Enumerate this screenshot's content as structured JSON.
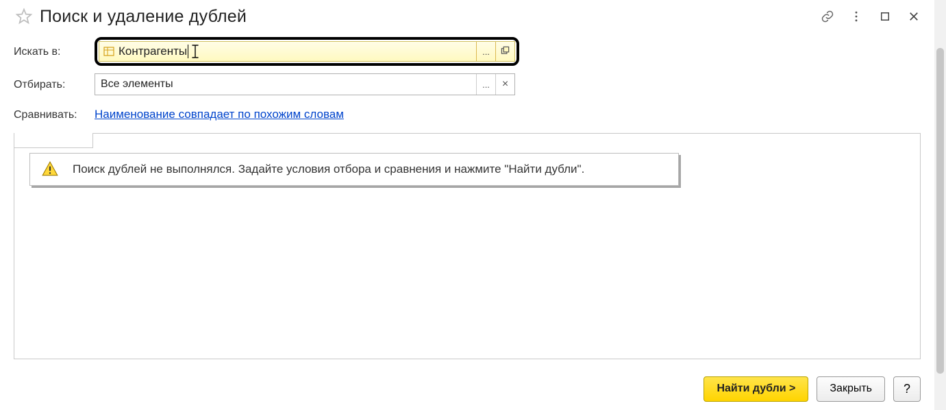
{
  "header": {
    "title": "Поиск и удаление дублей"
  },
  "form": {
    "search_in_label": "Искать в:",
    "search_in_value": "Контрагенты",
    "filter_label": "Отбирать:",
    "filter_value": "Все элементы",
    "compare_label": "Сравнивать:",
    "compare_link": "Наименование совпадает по похожим словам"
  },
  "info": {
    "message": "Поиск дублей не выполнялся.  Задайте условия отбора и сравнения и нажмите \"Найти дубли\"."
  },
  "footer": {
    "find_label": "Найти дубли >",
    "close_label": "Закрыть",
    "help_label": "?"
  },
  "glyphs": {
    "ellipsis": "...",
    "times": "×"
  }
}
